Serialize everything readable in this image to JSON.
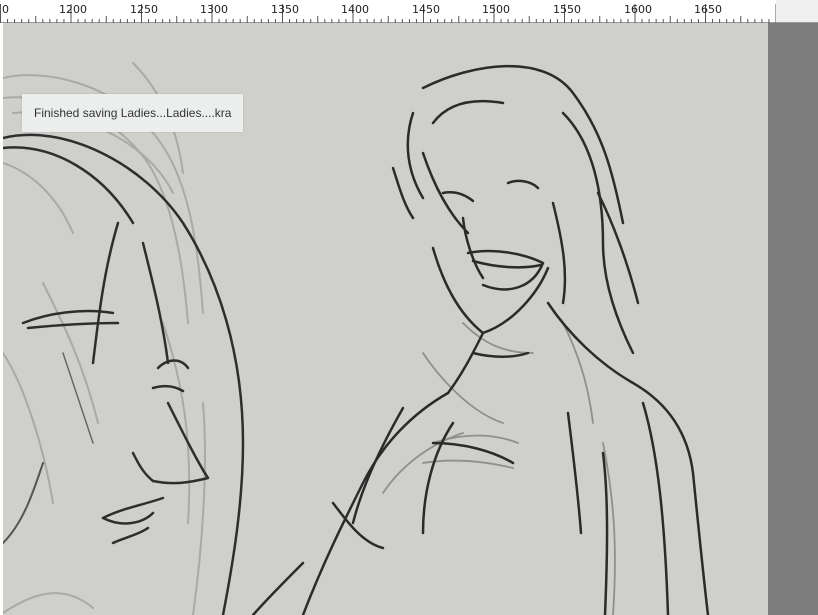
{
  "ruler": {
    "start_label": "0",
    "labels": [
      "1200",
      "1250",
      "1300",
      "1350",
      "1400",
      "1450",
      "1500",
      "1550",
      "1600",
      "1650"
    ]
  },
  "notification": {
    "text": "Finished saving Ladies...Ladies....kra"
  },
  "colors": {
    "canvas": "#cfd0cb",
    "stroke": "#2b2b2b",
    "ruler_bg": "#ffffff",
    "gutter": "#7c7c7c"
  }
}
